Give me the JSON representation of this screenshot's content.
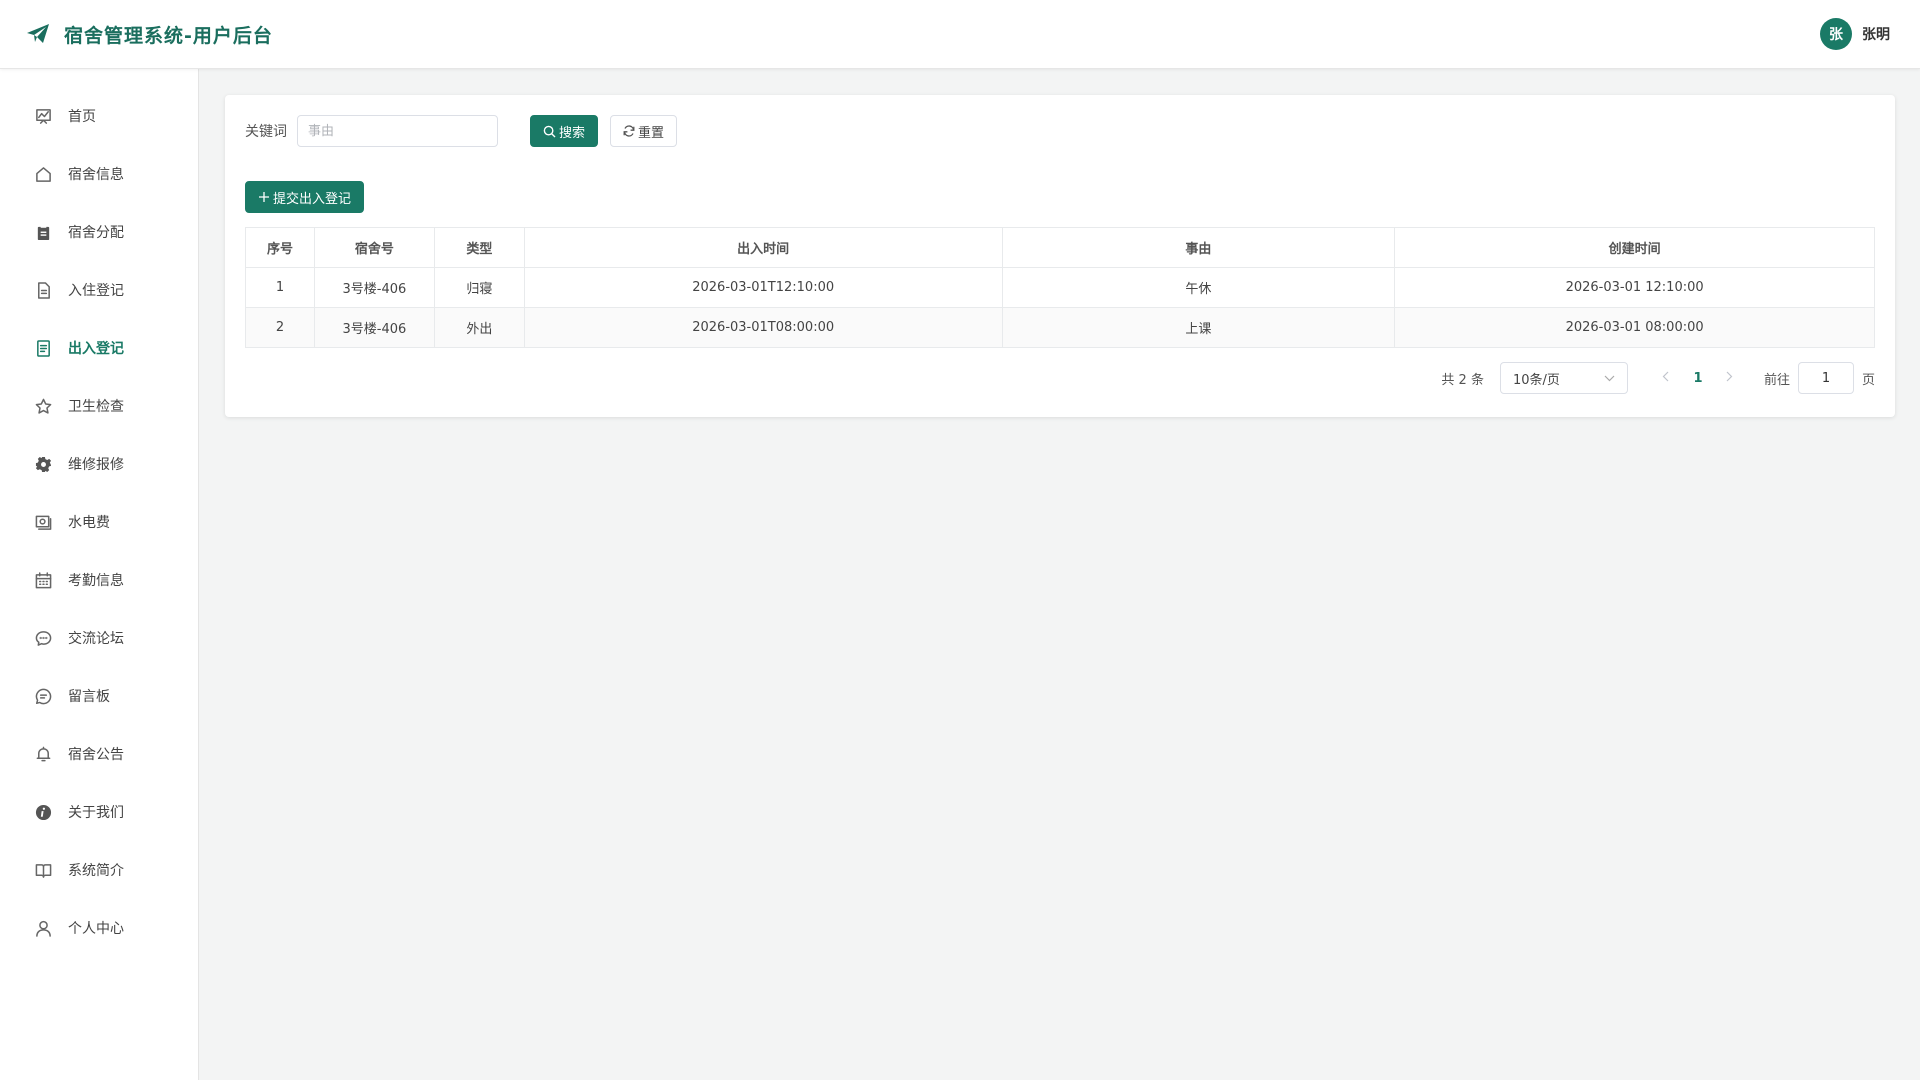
{
  "header": {
    "title": "宿舍管理系统-用户后台",
    "avatar_initial": "张",
    "username": "张明"
  },
  "sidebar": {
    "items": [
      {
        "label": "首页",
        "icon": "chart-icon"
      },
      {
        "label": "宿舍信息",
        "icon": "house-icon"
      },
      {
        "label": "宿舍分配",
        "icon": "clipboard-icon"
      },
      {
        "label": "入住登记",
        "icon": "document-icon"
      },
      {
        "label": "出入登记",
        "icon": "tickets-icon",
        "active": true
      },
      {
        "label": "卫生检查",
        "icon": "star-icon"
      },
      {
        "label": "维修报修",
        "icon": "gear-icon"
      },
      {
        "label": "水电费",
        "icon": "money-icon"
      },
      {
        "label": "考勤信息",
        "icon": "calendar-icon"
      },
      {
        "label": "交流论坛",
        "icon": "chat-icon"
      },
      {
        "label": "留言板",
        "icon": "message-icon"
      },
      {
        "label": "宿舍公告",
        "icon": "bell-icon"
      },
      {
        "label": "关于我们",
        "icon": "info-icon"
      },
      {
        "label": "系统简介",
        "icon": "book-icon"
      },
      {
        "label": "个人中心",
        "icon": "user-icon"
      }
    ]
  },
  "search": {
    "label": "关键词",
    "placeholder": "事由",
    "value": "",
    "search_btn": "搜索",
    "reset_btn": "重置"
  },
  "actions": {
    "add_btn": "提交出入登记"
  },
  "table": {
    "columns": [
      "序号",
      "宿舍号",
      "类型",
      "出入时间",
      "事由",
      "创建时间"
    ],
    "rows": [
      [
        "1",
        "3号楼-406",
        "归寝",
        "2026-03-01T12:10:00",
        "午休",
        "2026-03-01 12:10:00"
      ],
      [
        "2",
        "3号楼-406",
        "外出",
        "2026-03-01T08:00:00",
        "上课",
        "2026-03-01 08:00:00"
      ]
    ]
  },
  "pagination": {
    "total": "共 2 条",
    "page_size": "10条/页",
    "current_page": "1",
    "goto_label": "前往",
    "goto_value": "1",
    "page_suffix": "页"
  },
  "colors": {
    "accent": "#1a7a66",
    "background": "#f3f4f4"
  }
}
